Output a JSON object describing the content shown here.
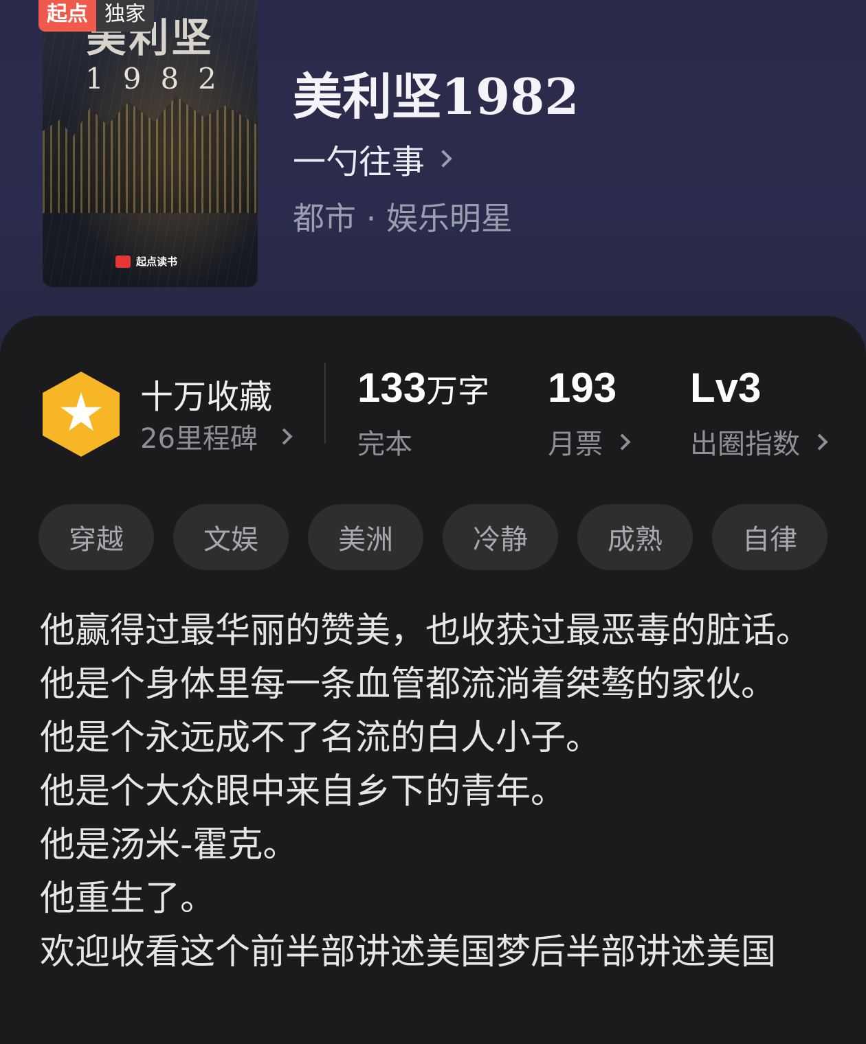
{
  "cover": {
    "badge_brand": "起点",
    "badge_exclusive": "独家",
    "art_title": "美利坚",
    "art_year": "1982",
    "publisher": "起点读书"
  },
  "book": {
    "title": "美利坚1982",
    "author": "一勺往事",
    "genre": "都市 · 娱乐明星"
  },
  "stats": {
    "favorites_title": "十万收藏",
    "milestones": "26里程碑",
    "word_count_num": "133",
    "word_count_unit": "万字",
    "status": "完本",
    "monthly_votes": "193",
    "monthly_votes_label": "月票",
    "level": "Lv3",
    "level_label": "出圈指数"
  },
  "tags": [
    "穿越",
    "文娱",
    "美洲",
    "冷静",
    "成熟",
    "自律"
  ],
  "description": [
    "他赢得过最华丽的赞美，也收获过最恶毒的脏话。",
    "他是个身体里每一条血管都流淌着桀骜的家伙。",
    "他是个永远成不了名流的白人小子。",
    "他是个大众眼中来自乡下的青年。",
    "他是汤米-霍克。",
    "他重生了。",
    "欢迎收看这个前半部讲述美国梦后半部讲述美国"
  ],
  "colors": {
    "hero_bg": "#2c2a4a",
    "card_bg": "#1b1b1d",
    "hex_badge": "#f7b626",
    "badge_red": "#f05a4d",
    "tag_bg": "#2e2e31"
  }
}
